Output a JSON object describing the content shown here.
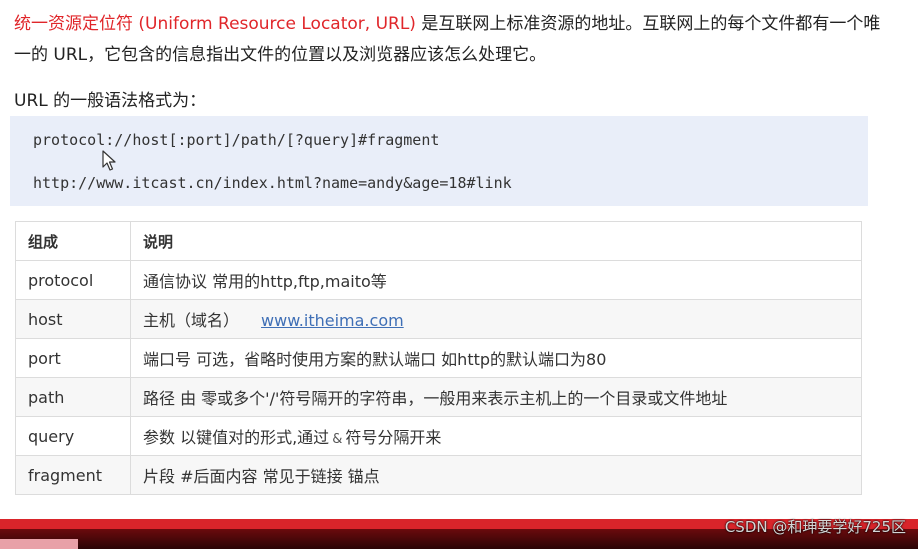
{
  "intro": {
    "highlight": "统一资源定位符 (Uniform Resource Locator, URL)",
    "rest": " 是互联网上标准资源的地址。互联网上的每个文件都有一个唯一的 URL，它包含的信息指出文件的位置以及浏览器应该怎么处理它。"
  },
  "syntax_label": "URL 的一般语法格式为：",
  "code": {
    "line1": "protocol://host[:port]/path/[?query]#fragment",
    "line2": "http://www.itcast.cn/index.html?name=andy&age=18#link"
  },
  "table": {
    "headers": [
      "组成",
      "说明"
    ],
    "rows": [
      {
        "name": "protocol",
        "desc": "通信协议 常用的http,ftp,maito等"
      },
      {
        "name": "host",
        "desc": "主机（域名）",
        "link": "www.itheima.com"
      },
      {
        "name": "port",
        "desc": "端口号 可选，省略时使用方案的默认端口 如http的默认端口为80"
      },
      {
        "name": "path",
        "desc": "路径 由 零或多个'/'符号隔开的字符串，一般用来表示主机上的一个目录或文件地址"
      },
      {
        "name": "query",
        "desc_before": "参数  以键值对的形式,通过",
        "desc_symbol": "&",
        "desc_after": "符号分隔开来"
      },
      {
        "name": "fragment",
        "desc": "片段  #后面内容 常见于链接 锚点"
      }
    ]
  },
  "video": {
    "progress": 0.0
  },
  "watermark": "CSDN @和珅要学好725区",
  "colors": {
    "highlight": "#e0262a",
    "code_bg": "#e9eef9",
    "link": "#3f6fb6",
    "progress": "#d9242a"
  }
}
